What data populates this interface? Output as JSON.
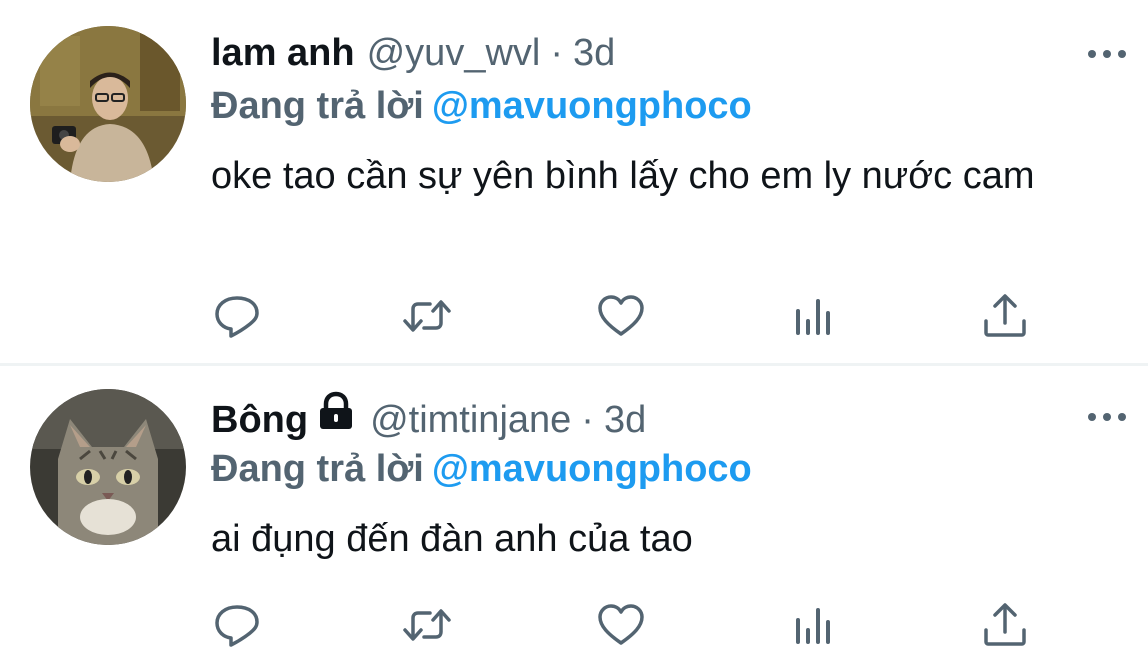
{
  "colors": {
    "text_primary": "#0f1419",
    "text_secondary": "#536471",
    "accent_blue": "#1d9bf0",
    "divider": "#eff3f4"
  },
  "tweets": [
    {
      "display_name": "lam anh",
      "handle": "@yuv_wvl",
      "separator": "·",
      "time": "3d",
      "protected": false,
      "reply_prefix": "Đang trả lời",
      "reply_to": "@mavuongphoco",
      "text": "oke tao cần sự yên bình lấy cho em ly nước cam",
      "avatar_icon": "profile-photo",
      "actions": [
        "reply-icon",
        "retweet-icon",
        "like-icon",
        "analytics-icon",
        "share-icon"
      ]
    },
    {
      "display_name": "Bông",
      "handle": "@timtinjane",
      "separator": "·",
      "time": "3d",
      "protected": true,
      "reply_prefix": "Đang trả lời",
      "reply_to": "@mavuongphoco",
      "text": "ai đụng đến đàn anh của tao",
      "avatar_icon": "cat-photo",
      "actions": [
        "reply-icon",
        "retweet-icon",
        "like-icon",
        "analytics-icon",
        "share-icon"
      ]
    }
  ]
}
